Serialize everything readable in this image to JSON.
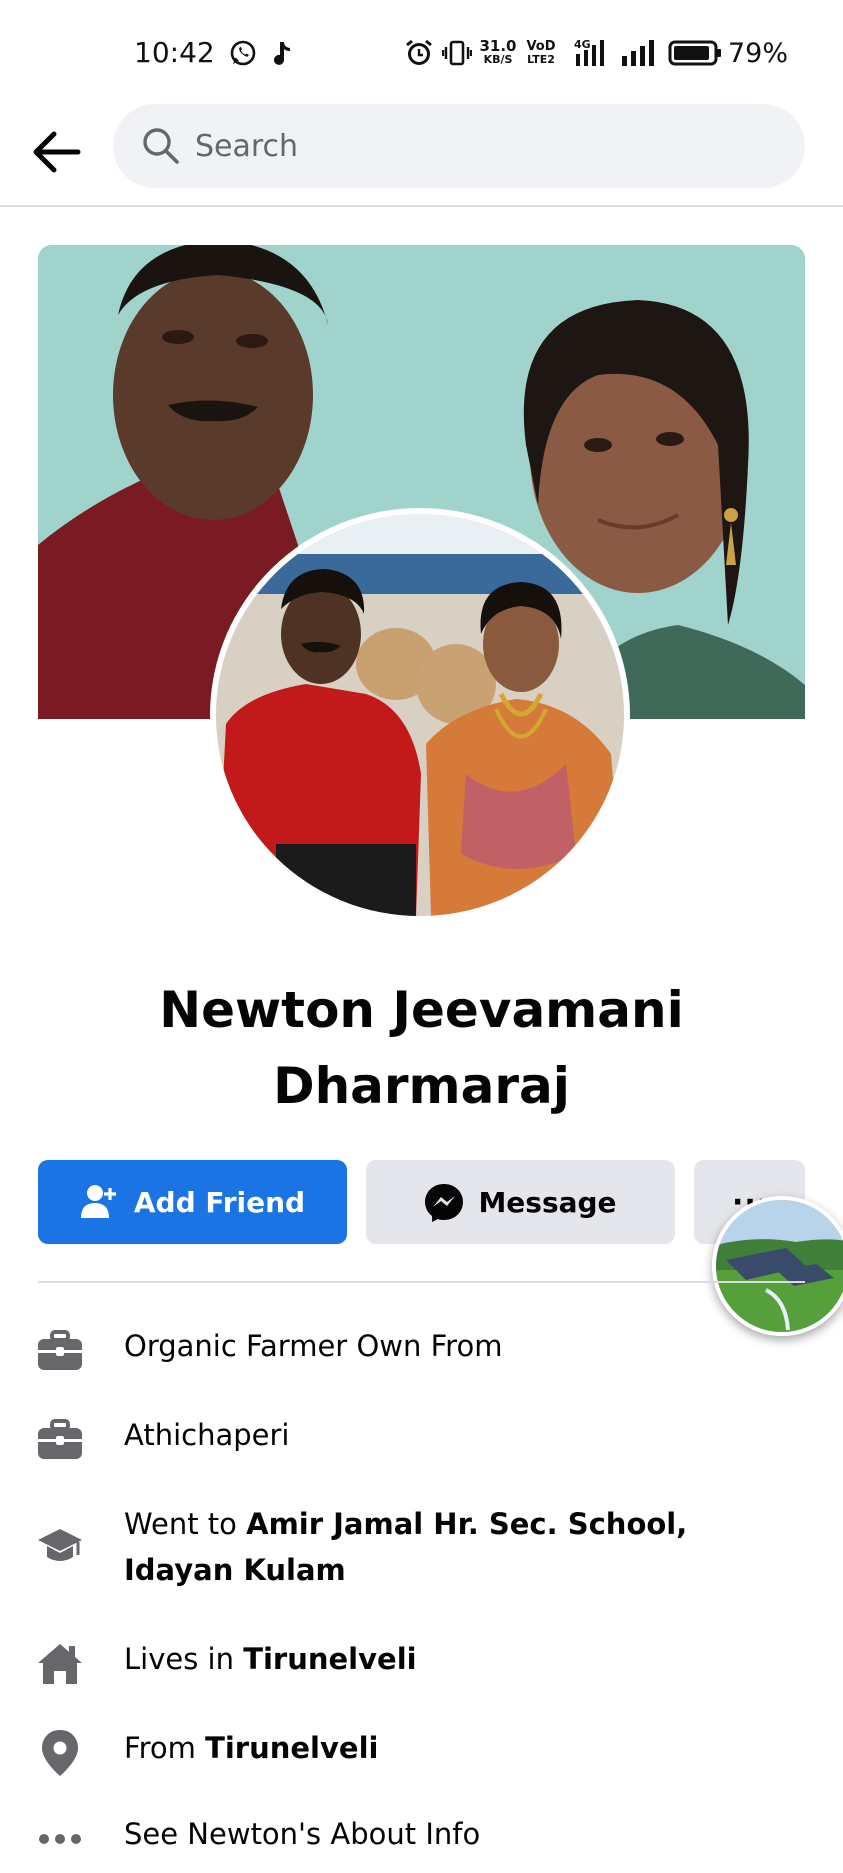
{
  "status_bar": {
    "time": "10:42",
    "net_speed_value": "31.0",
    "net_speed_unit": "KB/S",
    "volte_top": "VoD",
    "volte_bottom": "LTE2",
    "network_type": "4G",
    "battery_percent": "79%"
  },
  "search": {
    "placeholder": "Search"
  },
  "profile": {
    "name_line1": "Newton Jeevamani",
    "name_line2": "Dharmaraj"
  },
  "actions": {
    "add_friend_label": "Add Friend",
    "message_label": "Message",
    "more_label": "···"
  },
  "details": {
    "work1": "Organic Farmer Own From",
    "work2": "Athichaperi",
    "education_prefix": "Went to ",
    "education_place": "Amir Jamal Hr. Sec. School, Idayan Kulam",
    "lives_prefix": "Lives in ",
    "lives_place": "Tirunelveli",
    "from_prefix": "From ",
    "from_place": "Tirunelveli",
    "about_label": "See Newton's About Info"
  },
  "colors": {
    "primary_blue": "#1b74e4",
    "button_grey": "#e4e6eb",
    "icon_grey": "#65676b"
  }
}
